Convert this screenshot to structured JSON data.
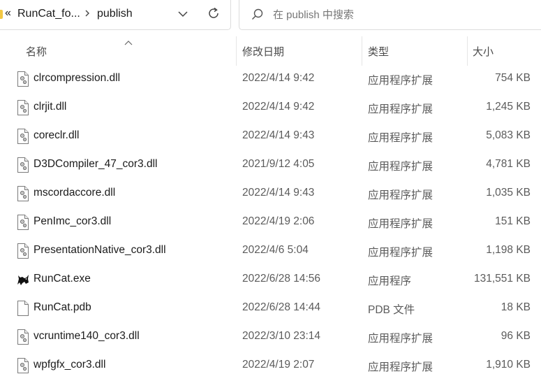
{
  "address_bar": {
    "overflow_label": "«",
    "breadcrumbs": [
      "RunCat_fo...",
      "publish"
    ],
    "dropdown_icon": "chevron-down-icon",
    "refresh_icon": "refresh-icon"
  },
  "search": {
    "placeholder": "在 publish 中搜索",
    "icon": "search-icon"
  },
  "columns": {
    "name": "名称",
    "date": "修改日期",
    "type": "类型",
    "size": "大小",
    "sort_icon": "sort-up-chevron-icon"
  },
  "files": [
    {
      "name": "clrcompression.dll",
      "date": "2022/4/14 9:42",
      "type": "应用程序扩展",
      "size": "754 KB",
      "icon": "dll-file-icon"
    },
    {
      "name": "clrjit.dll",
      "date": "2022/4/14 9:42",
      "type": "应用程序扩展",
      "size": "1,245 KB",
      "icon": "dll-file-icon"
    },
    {
      "name": "coreclr.dll",
      "date": "2022/4/14 9:43",
      "type": "应用程序扩展",
      "size": "5,083 KB",
      "icon": "dll-file-icon"
    },
    {
      "name": "D3DCompiler_47_cor3.dll",
      "date": "2021/9/12 4:05",
      "type": "应用程序扩展",
      "size": "4,781 KB",
      "icon": "dll-file-icon"
    },
    {
      "name": "mscordaccore.dll",
      "date": "2022/4/14 9:43",
      "type": "应用程序扩展",
      "size": "1,035 KB",
      "icon": "dll-file-icon"
    },
    {
      "name": "PenImc_cor3.dll",
      "date": "2022/4/19 2:06",
      "type": "应用程序扩展",
      "size": "151 KB",
      "icon": "dll-file-icon"
    },
    {
      "name": "PresentationNative_cor3.dll",
      "date": "2022/4/6 5:04",
      "type": "应用程序扩展",
      "size": "1,198 KB",
      "icon": "dll-file-icon"
    },
    {
      "name": "RunCat.exe",
      "date": "2022/6/28 14:56",
      "type": "应用程序",
      "size": "131,551 KB",
      "icon": "runcat-app-icon"
    },
    {
      "name": "RunCat.pdb",
      "date": "2022/6/28 14:44",
      "type": "PDB 文件",
      "size": "18 KB",
      "icon": "blank-file-icon"
    },
    {
      "name": "vcruntime140_cor3.dll",
      "date": "2022/3/10 23:14",
      "type": "应用程序扩展",
      "size": "96 KB",
      "icon": "dll-file-icon"
    },
    {
      "name": "wpfgfx_cor3.dll",
      "date": "2022/4/19 2:07",
      "type": "应用程序扩展",
      "size": "1,910 KB",
      "icon": "dll-file-icon"
    }
  ]
}
